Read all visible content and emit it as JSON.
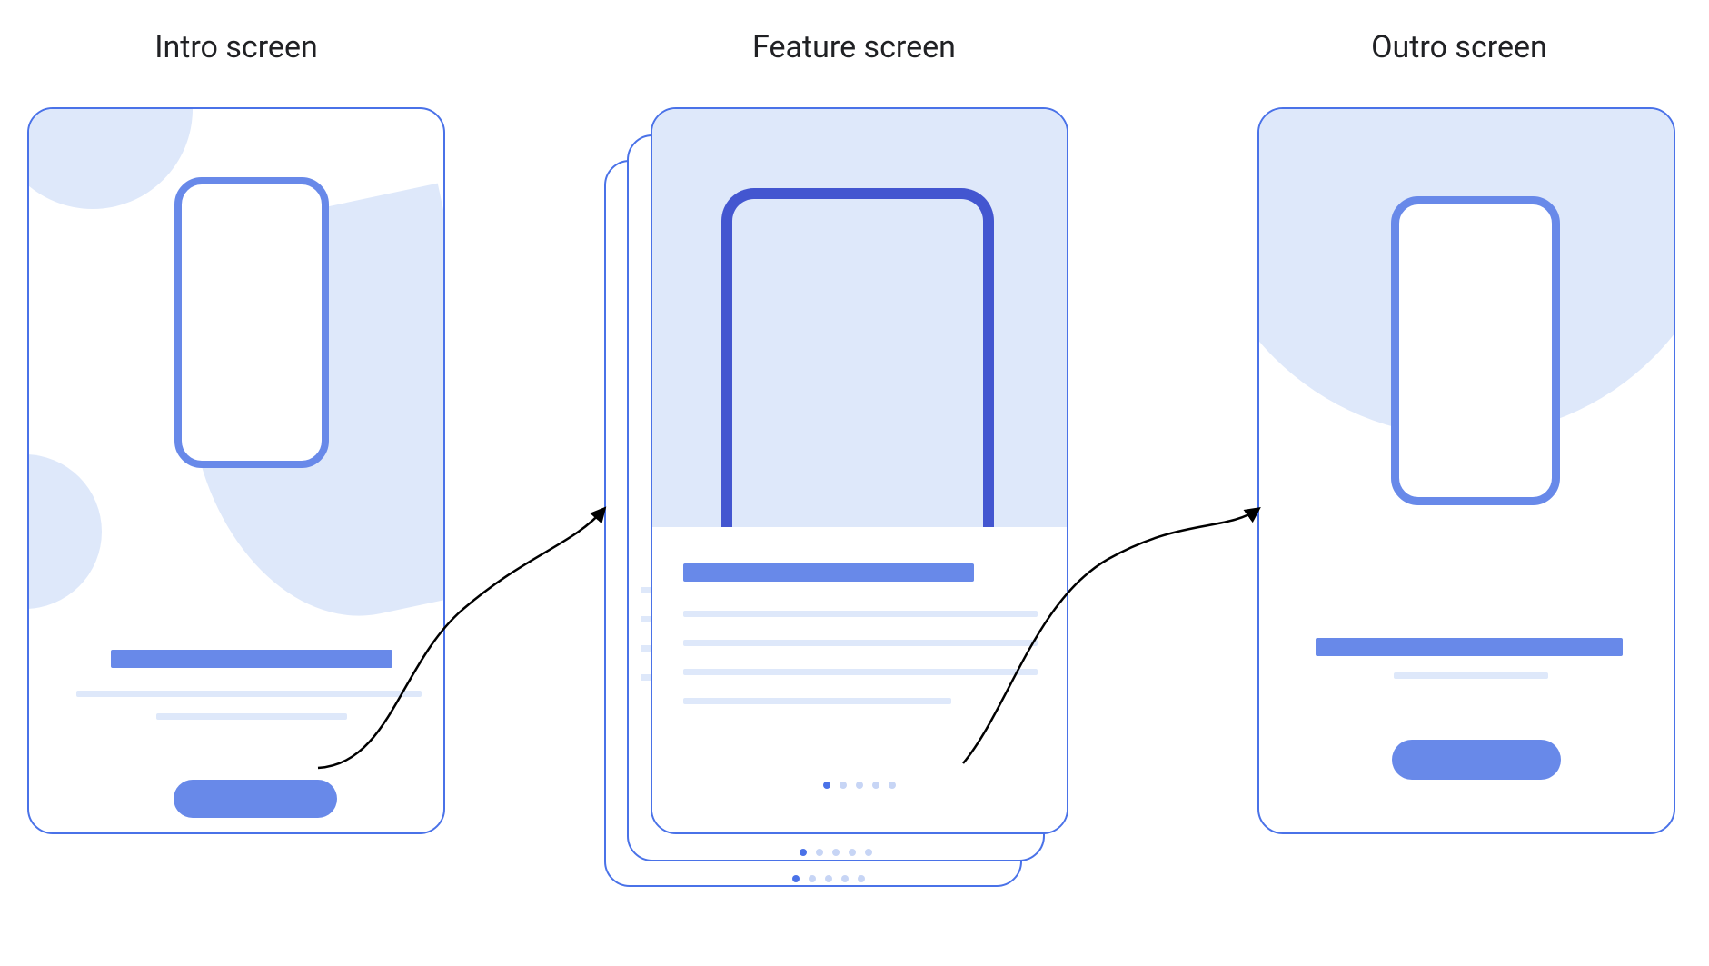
{
  "labels": {
    "intro": "Intro screen",
    "feature": "Feature screen",
    "outro": "Outro screen"
  },
  "feature_dots": {
    "count": 5,
    "active_index": 0
  },
  "colors": {
    "accent": "#6889e9",
    "accent_dark": "#4356d0",
    "outline": "#4a72e8",
    "pale": "#dee8fa"
  }
}
